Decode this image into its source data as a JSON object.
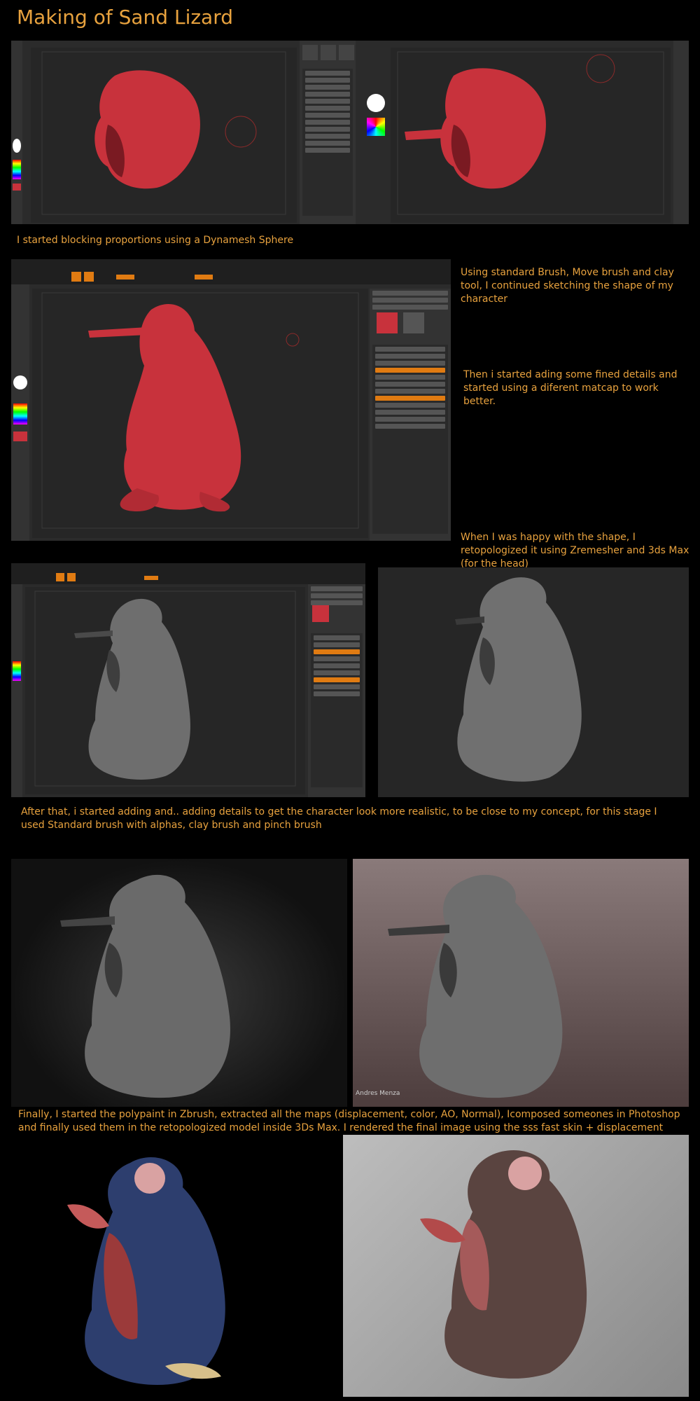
{
  "title": "Making of Sand Lizard",
  "captions": {
    "c1": "I started blocking proportions using a Dynamesh Sphere",
    "c2": "Using standard Brush, Move brush and clay tool, I continued sketching the shape of my character",
    "c3": "Then i started ading some fined details and started using a diferent matcap to work better.",
    "c4": "When I was happy with the shape, I retopologized it using Zremesher and 3ds Max (for the head)",
    "c5": "After that, i started adding and.. adding details to get the character look more realistic, to be close to my concept, for this stage I used Standard brush with alphas, clay brush and pinch brush",
    "c6": "Finally, I started the polypaint in Zbrush, extracted all the maps (displacement, color, AO, Normal), Icomposed someones in Photoshop and finally used them in the retopologized model inside 3Ds Max. I rendered the final image using the sss fast skin + displacement material"
  },
  "signature": "Andres  Menza",
  "colors": {
    "accent": "#e8a23e",
    "zbrush_orange": "#e07b12",
    "clay_red": "#c8323c",
    "clay_grey": "#6e6e6e",
    "background": "#000000"
  },
  "icons": [
    "zbrush-ui",
    "color-picker",
    "brush-icon",
    "material-sphere"
  ]
}
